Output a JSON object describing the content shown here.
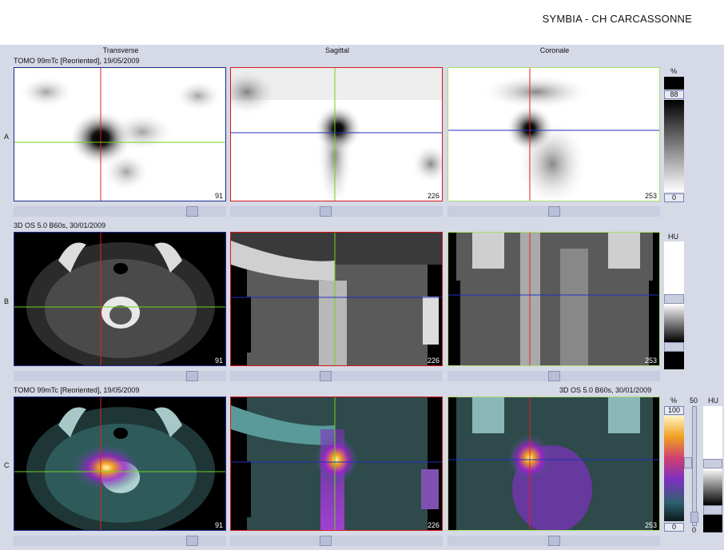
{
  "header": {
    "site_label": "SYMBIA - CH CARCASSONNE"
  },
  "columns": {
    "transverse": "Transverse",
    "sagittal": "Sagittal",
    "coronal": "Coronale"
  },
  "rows": {
    "a": {
      "label": "A",
      "info": "TOMO 99mTc [Reoriented], 19/05/2009"
    },
    "b": {
      "label": "B",
      "info": "3D  OS  5.0  B60s, 30/01/2009"
    },
    "c": {
      "label": "C",
      "info_left": "TOMO 99mTc [Reoriented], 19/05/2009",
      "info_right": "3D  OS  5.0  B60s, 30/01/2009"
    }
  },
  "slices": {
    "transverse": "91",
    "sagittal": "226",
    "coronal": "253"
  },
  "colorbars": {
    "a": {
      "unit": "%",
      "max": "88",
      "min": "0"
    },
    "b": {
      "unit": "HU"
    },
    "c": {
      "unit_pct": "%",
      "max": "100",
      "min": "0",
      "unit_hu": "HU",
      "hu_val": "50",
      "hu_min": "0"
    }
  },
  "colors": {
    "transverse_border": "#1a2a8c",
    "sagittal_border": "#d41818",
    "coronal_border": "#a8e070",
    "crosshair_red": "#e02020",
    "crosshair_green": "#70d020",
    "crosshair_blue": "#2030c0"
  }
}
